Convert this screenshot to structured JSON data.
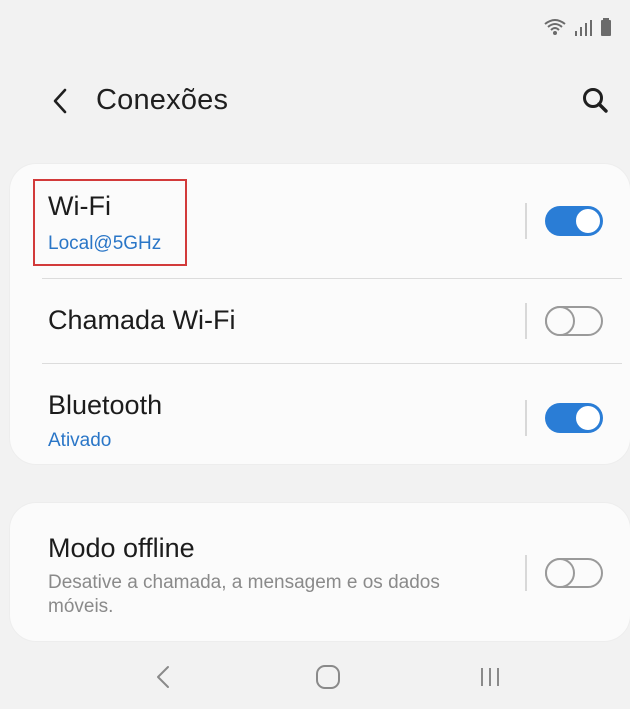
{
  "statusbar": {
    "icons": [
      "wifi-icon",
      "signal-icon",
      "battery-icon"
    ]
  },
  "header": {
    "title": "Conexões",
    "back_icon": "chevron-left-icon",
    "search_icon": "search-icon"
  },
  "connections": [
    {
      "label": "Wi-Fi",
      "sublabel": "Local@5GHz",
      "enabled": true
    },
    {
      "label": "Chamada Wi-Fi",
      "sublabel": "",
      "enabled": false
    },
    {
      "label": "Bluetooth",
      "sublabel": "Ativado",
      "enabled": true
    }
  ],
  "offline": {
    "label": "Modo offline",
    "description_line1": "Desative a chamada, a mensagem e os dados",
    "description_line2": "móveis.",
    "enabled": false
  },
  "navbar": {
    "icons": [
      "back-nav-icon",
      "home-nav-icon",
      "recents-nav-icon"
    ]
  },
  "colors": {
    "accent": "#2a7dd6",
    "link_text": "#2a76c7",
    "highlight_box": "#d23a3a",
    "background": "#f2f2f2"
  }
}
